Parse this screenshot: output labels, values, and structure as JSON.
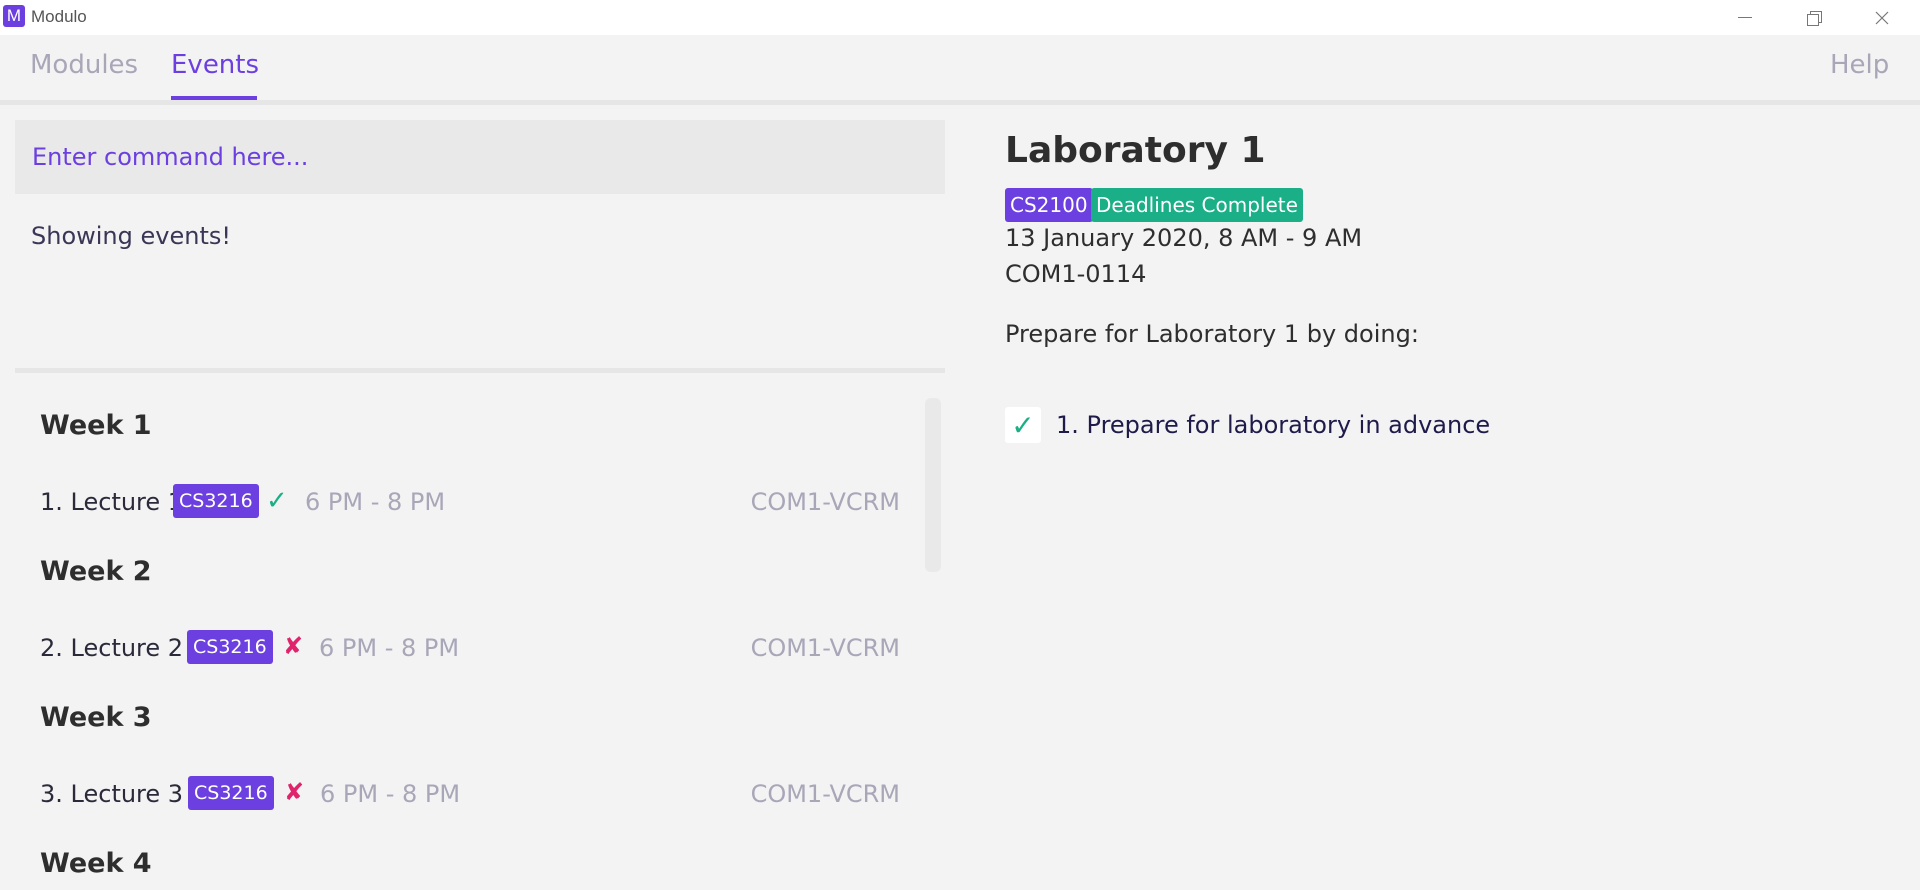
{
  "window": {
    "app_icon_letter": "M",
    "title": "Modulo"
  },
  "tabs": [
    {
      "label": "Modules",
      "active": false
    },
    {
      "label": "Events",
      "active": true
    }
  ],
  "help_label": "Help",
  "command": {
    "placeholder": "Enter command here...",
    "value": ""
  },
  "result_message": "Showing events!",
  "weeks": [
    {
      "title": "Week 1",
      "event": {
        "name": "1. Lecture 1",
        "module": "CS3216",
        "status": "complete",
        "status_icon": "check-icon",
        "time": "6 PM - 8 PM",
        "venue": "COM1-VCRM"
      }
    },
    {
      "title": "Week 2",
      "event": {
        "name": "2. Lecture 2",
        "module": "CS3216",
        "status": "incomplete",
        "status_icon": "cross-icon",
        "time": "6 PM - 8 PM",
        "venue": "COM1-VCRM"
      }
    },
    {
      "title": "Week 3",
      "event": {
        "name": "3. Lecture 3",
        "module": "CS3216",
        "status": "incomplete",
        "status_icon": "cross-icon",
        "time": "6 PM - 8 PM",
        "venue": "COM1-VCRM"
      }
    },
    {
      "title": "Week 4"
    }
  ],
  "detail": {
    "title": "Laboratory 1",
    "module_tag": "CS2100",
    "status_tag": "Deadlines Complete",
    "datetime": "13 January 2020, 8 AM - 9 AM",
    "venue": "COM1-0114",
    "prepare_heading": "Prepare for Laboratory 1 by doing:",
    "deadlines": [
      {
        "text": "1. Prepare for laboratory in advance",
        "done": true
      }
    ]
  },
  "colors": {
    "accent": "#6c3fe0",
    "complete": "#1aaf86",
    "incomplete": "#e0246c",
    "muted": "#a9a6b8"
  }
}
